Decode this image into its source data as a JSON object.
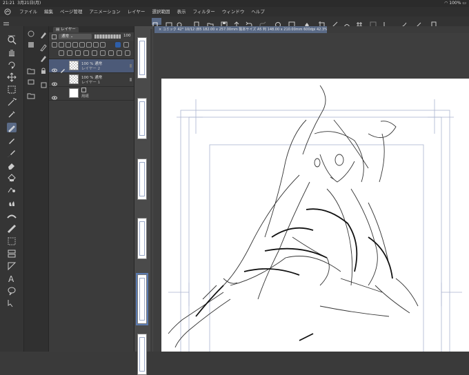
{
  "status": {
    "time": "21:21",
    "date": "3月21日(月)",
    "battery": "100%"
  },
  "menu": {
    "items": [
      "ファイル",
      "編集",
      "ページ管理",
      "アニメーション",
      "レイヤー",
      "選択範囲",
      "表示",
      "フィルター",
      "ウィンドウ",
      "ヘルプ"
    ]
  },
  "layers": {
    "tab_label": "レイヤー",
    "blend_mode": "通常",
    "opacity": "100",
    "rows": [
      {
        "opacity_mode": "100 % 通常",
        "name": "レイヤー 2",
        "selected": true,
        "transparent": true
      },
      {
        "opacity_mode": "100 % 通常",
        "name": "レイヤー 1",
        "selected": false,
        "transparent": true
      },
      {
        "opacity_mode": "",
        "name": "用紙",
        "selected": false,
        "transparent": false
      }
    ]
  },
  "document": {
    "tab_label": "× コミック 42° 10/12 (B5 182.00 x 257.00mm 製本サイズ A5 判 148.00 x 210.00mm 600dpi 42.3%)"
  },
  "icons": {
    "tools": [
      "magnifier-icon",
      "hand-icon",
      "rotate-icon",
      "move-icon",
      "selection-icon",
      "wand-icon",
      "eyedropper-icon",
      "pen-icon",
      "pencil-icon",
      "brush-icon",
      "eraser-icon",
      "fill-icon",
      "gradient-icon",
      "blend-icon",
      "figure-icon",
      "ruler-icon",
      "frame-icon",
      "text-icon",
      "balloon-icon",
      "correct-line-icon"
    ]
  },
  "colors": {
    "accent": "#5a6a86",
    "panel": "#3b3b3b",
    "paper": "#ffffff"
  }
}
